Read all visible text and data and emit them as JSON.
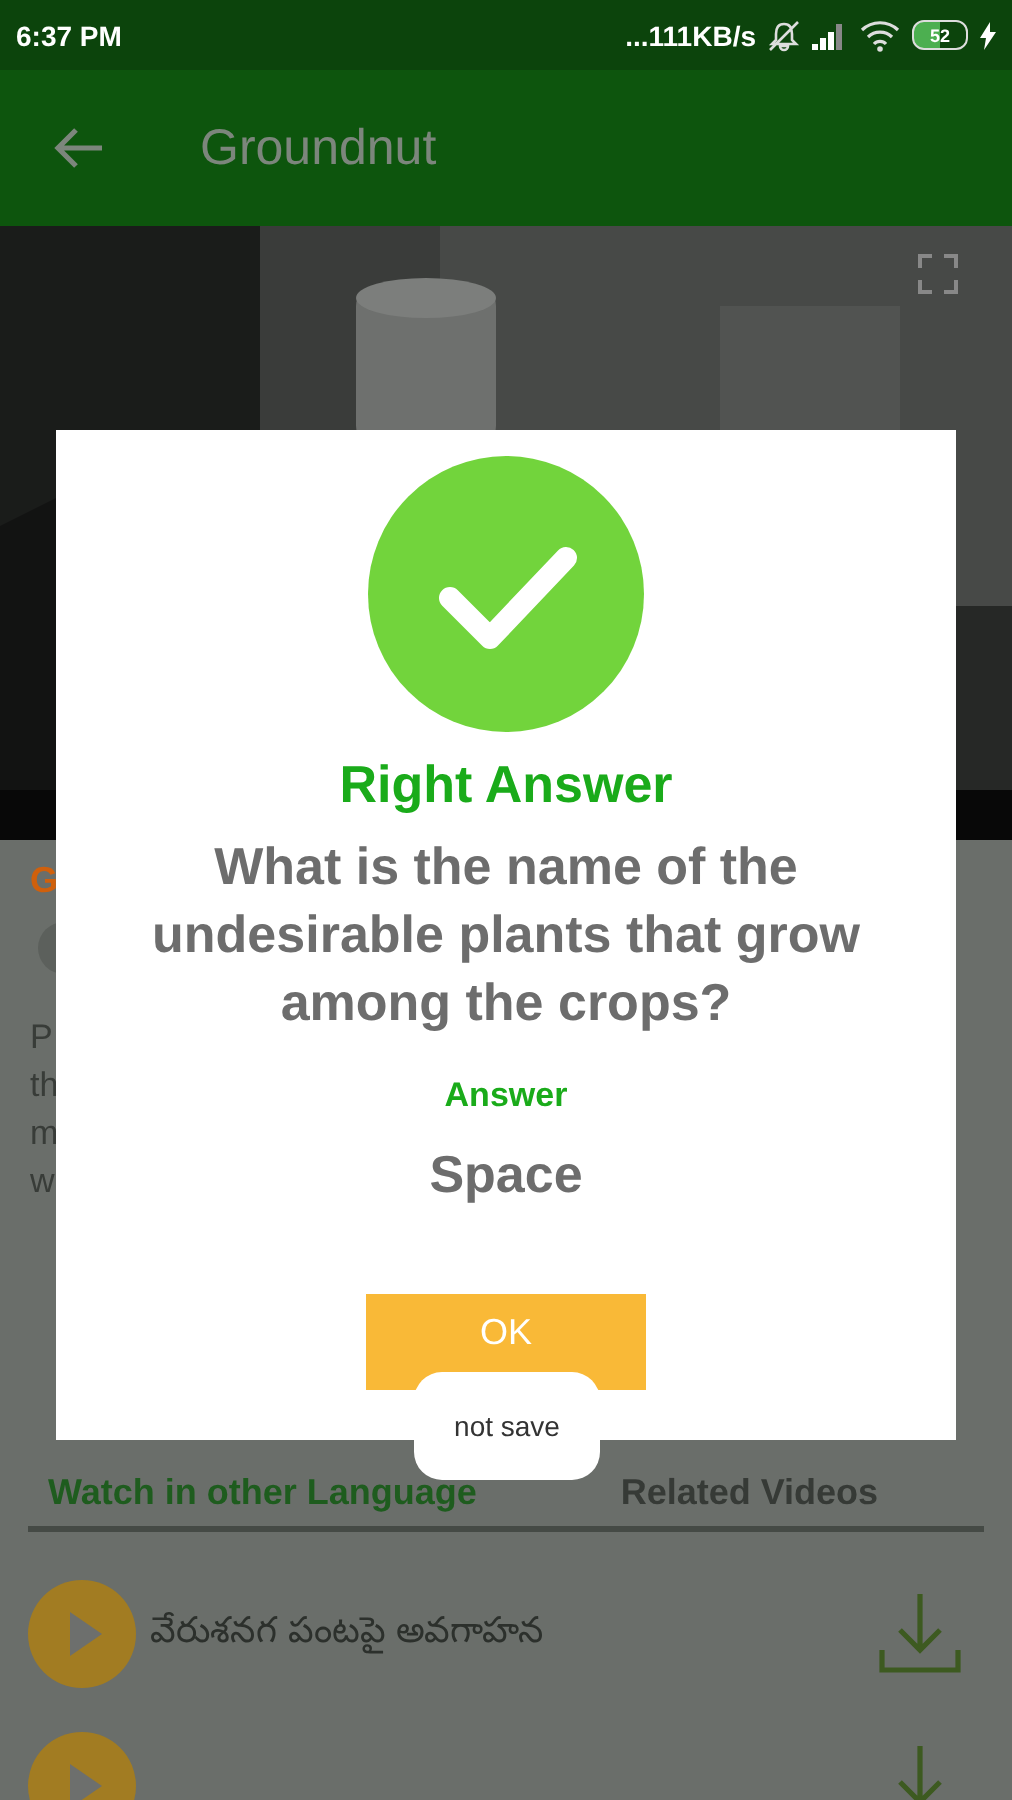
{
  "status_bar": {
    "time": "6:37 PM",
    "network_speed": "...111KB/s",
    "battery": "52",
    "charging": true
  },
  "app_bar": {
    "title": "Groundnut"
  },
  "background_fragments": {
    "title": "G",
    "description_lines": [
      "P",
      "th",
      "m",
      "w"
    ]
  },
  "tabs": [
    {
      "label": "Watch in other Language",
      "selected": true
    },
    {
      "label": "Related Videos",
      "selected": false
    }
  ],
  "videos": [
    {
      "kind": "full",
      "title": "వేరుశనగ పంటపై అవగాహన"
    },
    {
      "kind": "partial"
    }
  ],
  "dialog": {
    "correct": true,
    "result": "Right Answer",
    "question": "What is the name of the undesirable plants that grow among the crops?",
    "answer_label": "Answer",
    "answer": "Space",
    "button": "OK"
  },
  "toast": {
    "text": "not save"
  }
}
